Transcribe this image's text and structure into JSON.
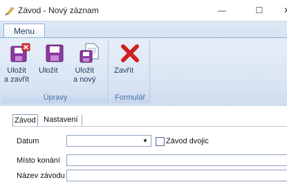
{
  "window": {
    "title": "Závod - Nový záznam",
    "icon": "pen-feather-icon",
    "controls": {
      "minimize": "—",
      "maximize": "☐",
      "close": "✕"
    }
  },
  "ribbon": {
    "tab_label": "Menu",
    "groups": [
      {
        "caption": "Úpravy",
        "buttons": [
          {
            "label_line1": "Uložit",
            "label_line2": "a zavřít",
            "icon": "save-close-icon"
          },
          {
            "label_line1": "Uložit",
            "label_line2": "",
            "icon": "save-icon"
          },
          {
            "label_line1": "Uložit",
            "label_line2": "a nový",
            "icon": "save-new-icon"
          }
        ]
      },
      {
        "caption": "Formulář",
        "buttons": [
          {
            "label_line1": "Zavřít",
            "label_line2": "",
            "icon": "close-x-icon"
          }
        ]
      }
    ]
  },
  "form": {
    "tabs": [
      "Závod",
      "Nastavení"
    ],
    "active_tab": "Závod",
    "fields": {
      "datum": {
        "label": "Datum",
        "value": ""
      },
      "zavod_dvojic": {
        "label": "Závod dvojic",
        "checked": false
      },
      "misto_konani": {
        "label": "Místo konání",
        "value": ""
      },
      "nazev_zavodu": {
        "label": "Název závodu",
        "value": ""
      }
    }
  },
  "colors": {
    "ribbon_bg": "#dbe6f4",
    "save_icon": "#7a2a8c",
    "close_icon": "#d11f1f",
    "group_caption": "#4a72a4"
  }
}
